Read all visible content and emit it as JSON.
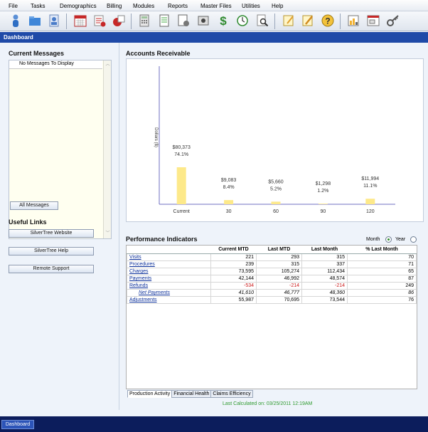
{
  "menu": [
    "File",
    "Tasks",
    "Demographics",
    "Billing",
    "Modules",
    "Reports",
    "Master Files",
    "Utilities",
    "Help"
  ],
  "toolbar": {
    "icons": [
      "person-icon",
      "folder-icon",
      "patient-list-icon",
      "calendar-icon",
      "claim-icon",
      "payment-icon",
      "calculator-icon",
      "document-icon",
      "report-icon",
      "disk-icon",
      "dollar-icon",
      "clock-icon",
      "search-icon",
      "note-icon",
      "edit-icon",
      "help-icon",
      "chart-icon",
      "window-icon",
      "key-icon"
    ]
  },
  "title": "Dashboard",
  "messages": {
    "heading": "Current Messages",
    "empty_text": "No Messages To Display",
    "all_button": "All Messages"
  },
  "useful_links": {
    "heading": "Useful Links",
    "buttons": [
      "SilverTree Website",
      "SilverTree Help",
      "Remote Support"
    ]
  },
  "accounts_receivable": {
    "heading": "Accounts Receivable"
  },
  "chart_data": {
    "type": "bar",
    "ylabel": "Dollars ($)",
    "categories": [
      "Current",
      "30",
      "60",
      "90",
      "120"
    ],
    "values": [
      80373,
      9083,
      5660,
      1298,
      11994
    ],
    "value_labels": [
      "$80,373",
      "$9,083",
      "$5,660",
      "$1,298",
      "$11,994"
    ],
    "percent_labels": [
      "74.1%",
      "8.4%",
      "5.2%",
      "1.2%",
      "11.1%"
    ],
    "color": "#fde98a"
  },
  "performance": {
    "heading": "Performance Indicators",
    "toggle": {
      "month": "Month",
      "year": "Year",
      "selected": "Month"
    },
    "columns": [
      "",
      "Current MTD",
      "Last MTD",
      "Last Month",
      "% Last Month"
    ],
    "rows": [
      {
        "label": "Visits",
        "values": [
          "221",
          "293",
          "315",
          "70"
        ]
      },
      {
        "label": "Procedures",
        "values": [
          "239",
          "315",
          "337",
          "71"
        ]
      },
      {
        "label": "Charges",
        "values": [
          "73,595",
          "105,274",
          "112,434",
          "65"
        ]
      },
      {
        "label": "Payments",
        "values": [
          "42,144",
          "46,992",
          "48,574",
          "87"
        ]
      },
      {
        "label": "Refunds",
        "values": [
          "-534",
          "-214",
          "-214",
          "249"
        ]
      },
      {
        "label": "Net Payments",
        "values": [
          "41,610",
          "46,777",
          "48,360",
          "86"
        ]
      },
      {
        "label": "Adjustments",
        "values": [
          "55,987",
          "70,695",
          "73,544",
          "76"
        ]
      }
    ],
    "tabs": [
      "Production Activity",
      "Financial Health",
      "Claims Efficiency"
    ],
    "last_calculated": "Last Calculated on: 03/25/2011 12:19AM"
  },
  "bottom": {
    "tab": "Dashboard"
  }
}
